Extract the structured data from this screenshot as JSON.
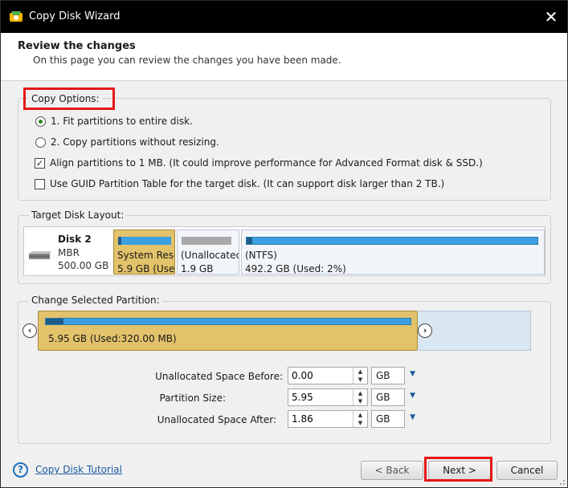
{
  "window": {
    "title": "Copy Disk Wizard",
    "close_glyph": "✕"
  },
  "header": {
    "title": "Review the changes",
    "subtitle": "On this page you can review the changes you have been made."
  },
  "copy_options": {
    "legend": "Copy Options:",
    "options": [
      {
        "type": "radio",
        "checked": true,
        "label": "1. Fit partitions to entire disk."
      },
      {
        "type": "radio",
        "checked": false,
        "label": "2. Copy partitions without resizing."
      },
      {
        "type": "checkbox",
        "checked": true,
        "label": "Align partitions to 1 MB.  (It could improve performance for Advanced Format disk & SSD.)"
      },
      {
        "type": "checkbox",
        "checked": false,
        "label": "Use GUID Partition Table for the target disk. (It can support disk larger than 2 TB.)"
      }
    ]
  },
  "target_layout": {
    "legend": "Target Disk Layout:",
    "disk": {
      "name": "Disk 2",
      "type": "MBR",
      "size": "500.00 GB",
      "icon": "hard-disk-icon"
    },
    "partitions": [
      {
        "label": "System Rese",
        "size": "5.9 GB (Used",
        "selected": true,
        "bar_color": "#3ca0e0",
        "used_fraction": 0.05
      },
      {
        "label": "(Unallocatec",
        "size": "1.9 GB",
        "selected": false,
        "bar_color": "#a9a9a9",
        "used_fraction": 0
      },
      {
        "label": "(NTFS)",
        "size": "492.2 GB (Used: 2%)",
        "selected": false,
        "bar_color": "#3ca0e0",
        "used_fraction": 0.02
      }
    ]
  },
  "change_partition": {
    "legend": "Change Selected Partition:",
    "selected_text": "5.95 GB (Used:320.00 MB)",
    "left_arrow": "‹",
    "right_arrow": "›",
    "fields": [
      {
        "label": "Unallocated Space Before:",
        "value": "0.00",
        "unit": "GB"
      },
      {
        "label": "Partition Size:",
        "value": "5.95",
        "unit": "GB"
      },
      {
        "label": "Unallocated Space After:",
        "value": "1.86",
        "unit": "GB"
      }
    ]
  },
  "footer": {
    "help_glyph": "?",
    "tutorial_link": "Copy Disk Tutorial",
    "back_label": "< Back",
    "next_label": "Next >",
    "cancel_label": "Cancel"
  },
  "colors": {
    "highlight": "#e51616",
    "selected_partition": "#e2c26a",
    "partition_bar": "#3ca0e0",
    "link": "#1a5aa0"
  }
}
